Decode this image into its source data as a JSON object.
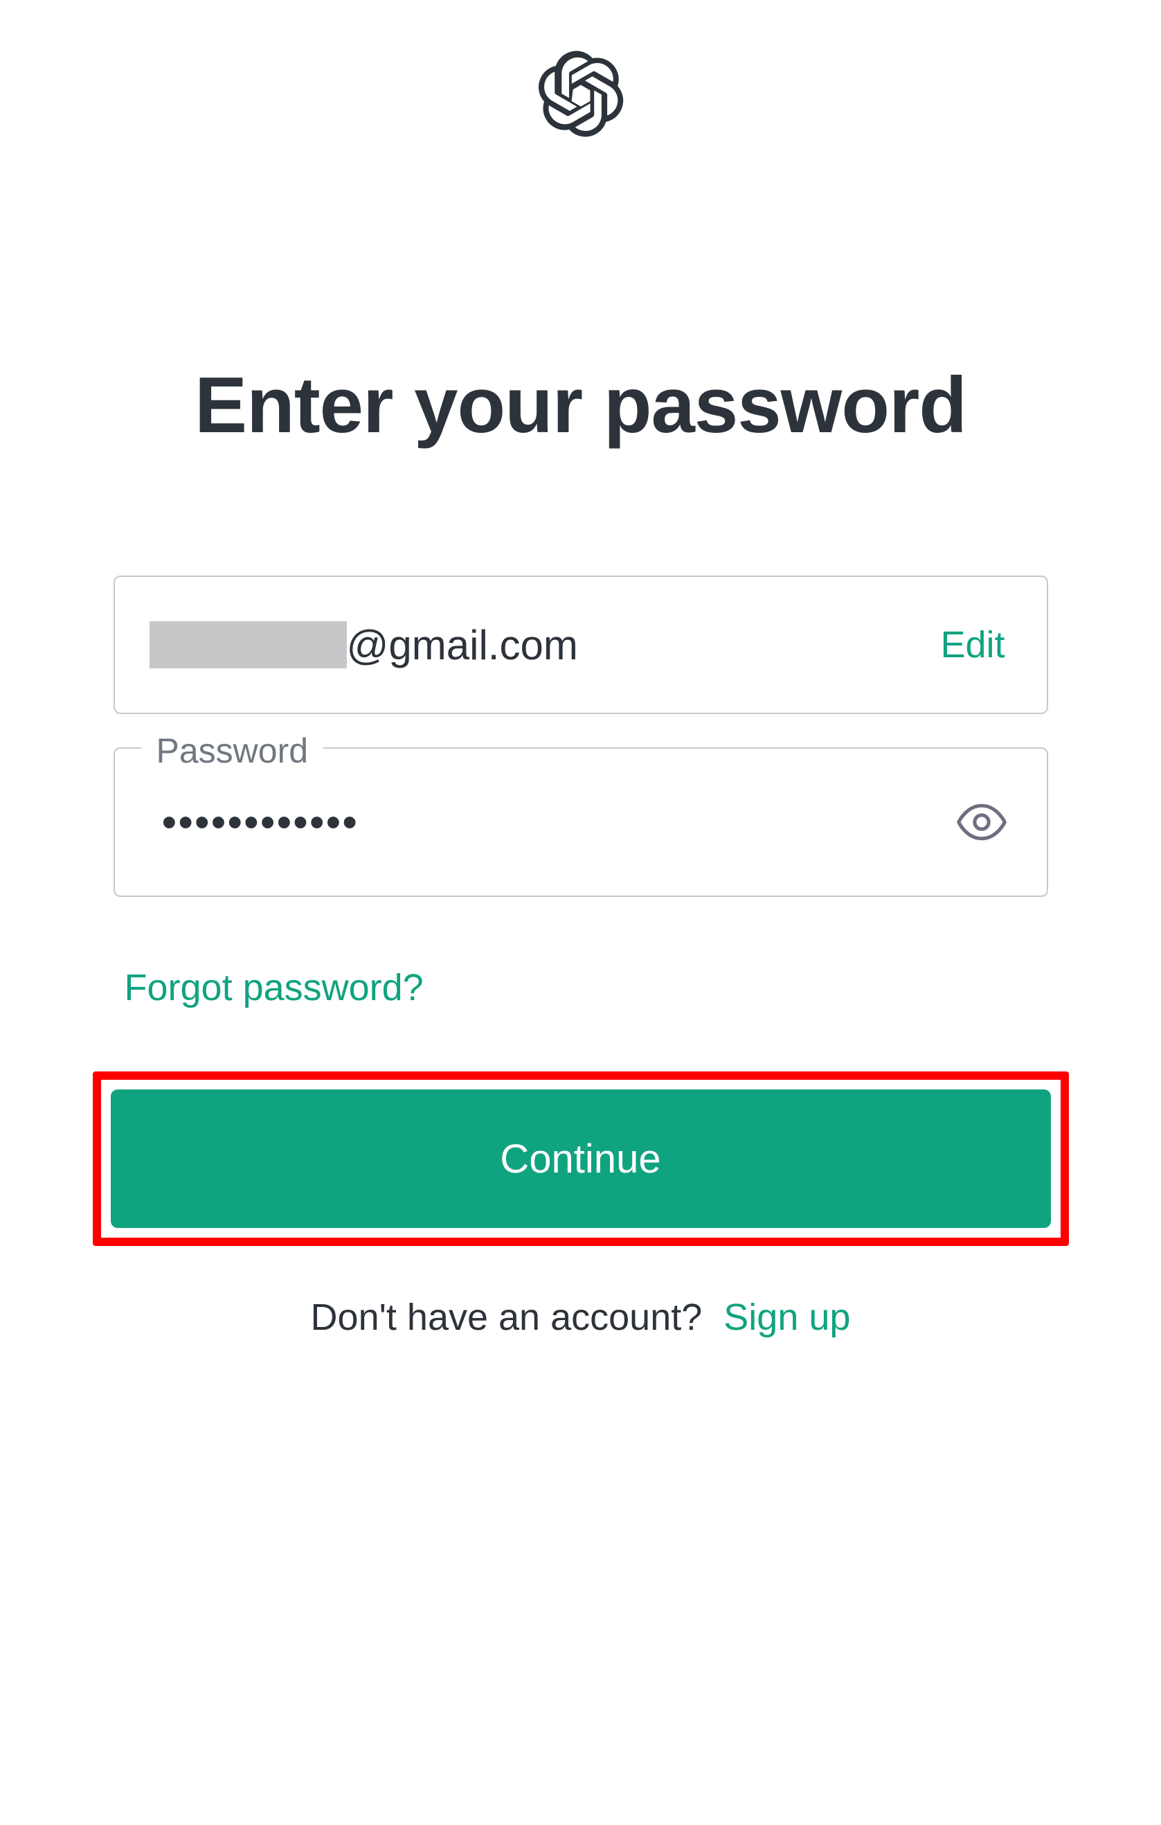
{
  "title": "Enter your password",
  "email": {
    "suffix": "@gmail.com",
    "edit_label": "Edit"
  },
  "password": {
    "label": "Password",
    "value": "●●●●●●●●●●●●"
  },
  "forgot_label": "Forgot password?",
  "continue_label": "Continue",
  "signup": {
    "prompt": "Don't have an account?",
    "link": "Sign up"
  },
  "colors": {
    "accent": "#10a37f",
    "highlight": "#ff0000"
  }
}
